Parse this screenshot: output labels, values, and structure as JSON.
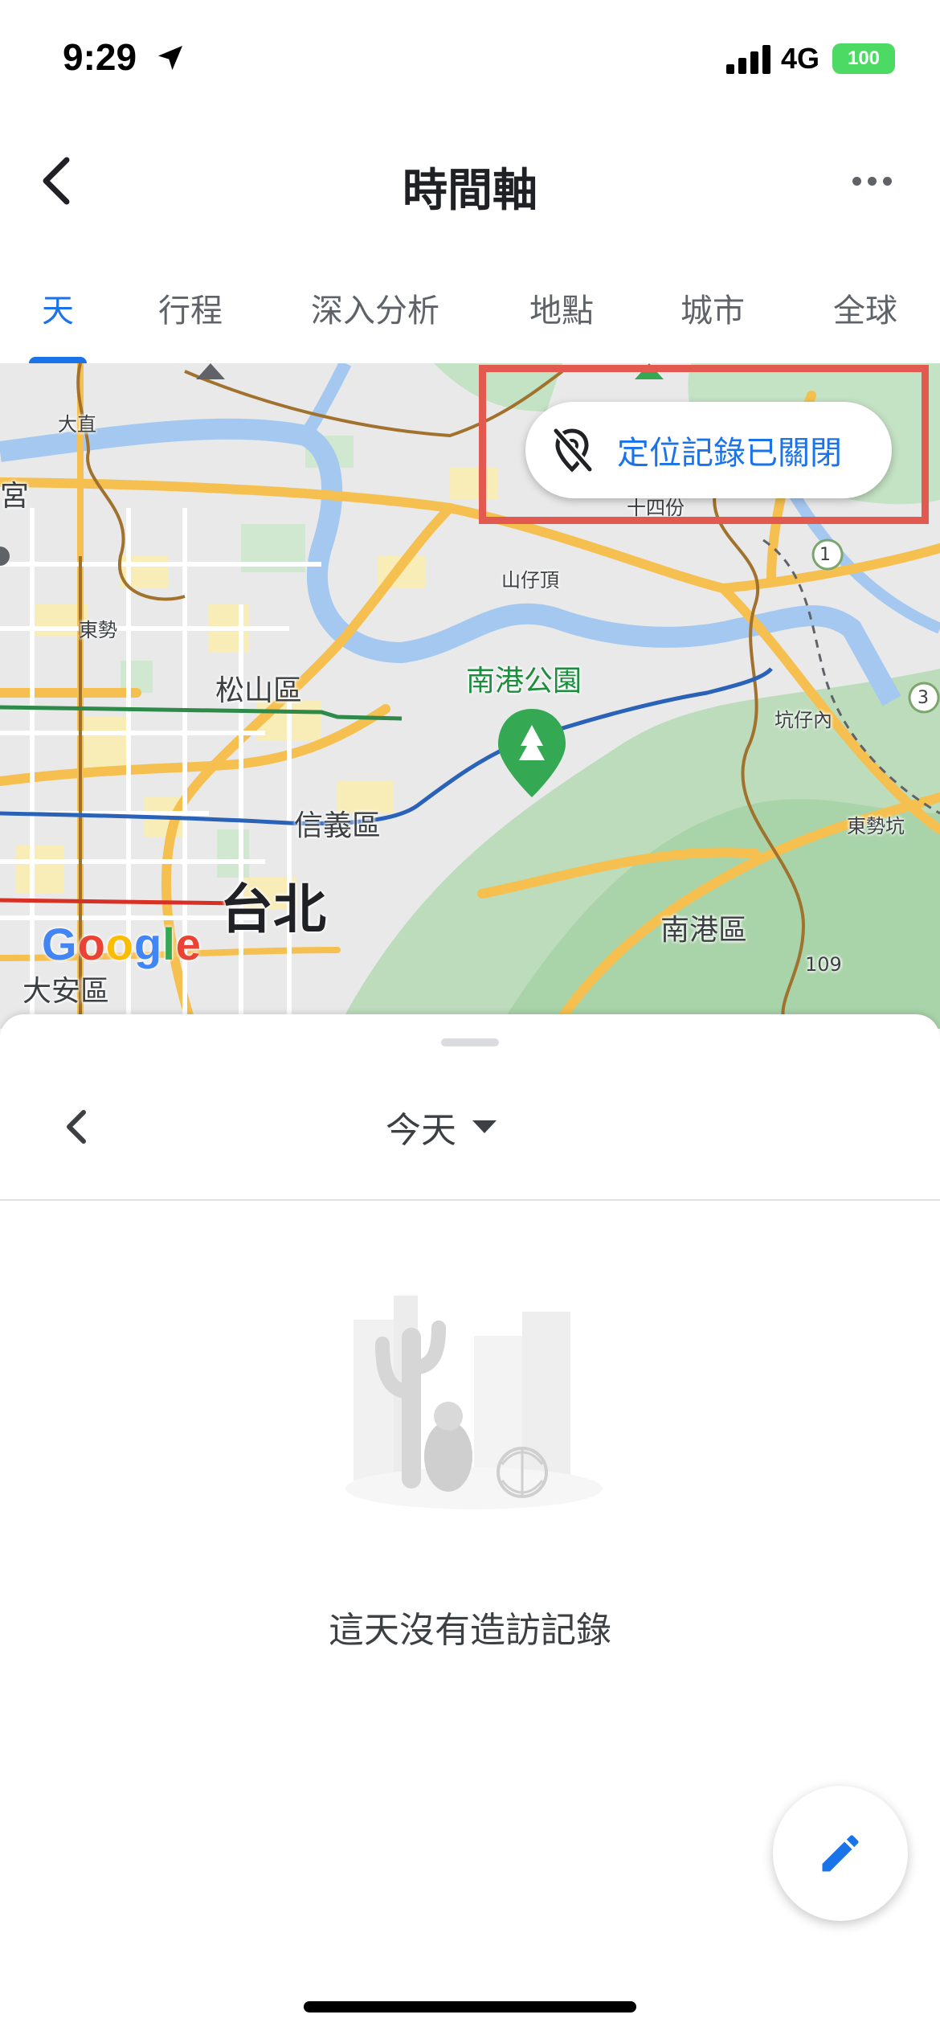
{
  "status_bar": {
    "time": "9:29",
    "network": "4G",
    "battery": "100"
  },
  "header": {
    "title": "時間軸"
  },
  "tabs": [
    {
      "label": "天",
      "active": true
    },
    {
      "label": "行程",
      "active": false
    },
    {
      "label": "深入分析",
      "active": false
    },
    {
      "label": "地點",
      "active": false
    },
    {
      "label": "城市",
      "active": false
    },
    {
      "label": "全球",
      "active": false
    }
  ],
  "map": {
    "labels": {
      "dazhi": "大直",
      "gong": "宮",
      "shisifen": "十四份",
      "shanzaiding": "山仔頂",
      "dongshi": "東勢",
      "songshan": "松山區",
      "nangang_park": "南港公園",
      "kengzainei": "坑仔內",
      "dongshikeng": "東勢坑",
      "xinyi": "信義區",
      "taipei": "台北",
      "nangang": "南港區",
      "route_109": "109",
      "daan": "大安區",
      "route_1": "1",
      "route_3": "3",
      "google": "Google"
    },
    "location_history_chip": "定位記錄已關閉"
  },
  "sheet": {
    "date_label": "今天",
    "empty_message": "這天沒有造訪記錄"
  },
  "colors": {
    "accent": "#1a73e8",
    "highlight_frame": "#e25a4f",
    "park_green": "#1e8e3e",
    "road": "#f5c04f"
  },
  "icons": {
    "back": "chevron-left-icon",
    "more": "more-horizontal-icon",
    "location_off": "location-off-icon",
    "edit": "pencil-icon",
    "dropdown": "caret-down-icon"
  }
}
